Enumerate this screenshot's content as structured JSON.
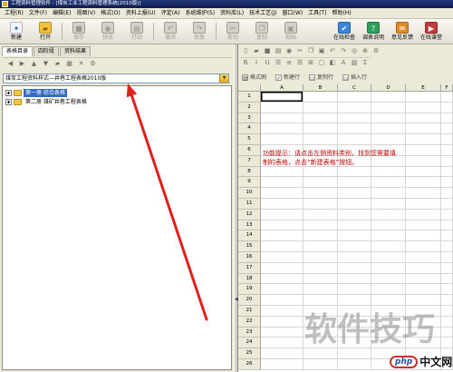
{
  "window": {
    "title": "工程资料管理软件 - [煤炭工业工程资料管理系统(2010版)]"
  },
  "menu": [
    "工程(R)",
    "文件(F)",
    "编辑(E)",
    "视图(V)",
    "格式(O)",
    "资料上报(U)",
    "评定(A)",
    "系统维护(S)",
    "资料库(L)",
    "技术工艺(J)",
    "窗口(W)",
    "工具(T)",
    "帮助(H)"
  ],
  "toolbar": {
    "buttons": [
      {
        "label": "新建",
        "icon": "new-file-icon",
        "enabled": true
      },
      {
        "label": "打开",
        "icon": "open-folder-icon",
        "enabled": true
      },
      {
        "label": "保存",
        "icon": "save-icon",
        "enabled": false
      },
      {
        "label": "预览",
        "icon": "preview-icon",
        "enabled": false
      },
      {
        "label": "打印",
        "icon": "print-icon",
        "enabled": false
      },
      {
        "label": "撤消",
        "icon": "undo-icon",
        "enabled": false
      },
      {
        "label": "恢复",
        "icon": "redo-icon",
        "enabled": false
      },
      {
        "label": "剪切",
        "icon": "cut-icon",
        "enabled": false
      },
      {
        "label": "复制",
        "icon": "copy-icon",
        "enabled": false
      },
      {
        "label": "粘贴",
        "icon": "paste-icon",
        "enabled": false
      }
    ],
    "right_buttons": [
      {
        "label": "在线检查",
        "icon": "online-check-icon",
        "enabled": true
      },
      {
        "label": "调表说明",
        "icon": "table-help-icon",
        "enabled": true
      },
      {
        "label": "意见反馈",
        "icon": "feedback-icon",
        "enabled": true
      },
      {
        "label": "在线课堂",
        "icon": "online-class-icon",
        "enabled": true
      }
    ]
  },
  "left_panel": {
    "tabs": [
      {
        "label": "表格目录",
        "active": true
      },
      {
        "label": "四阶段",
        "active": false
      },
      {
        "label": "资料结果",
        "active": false
      }
    ],
    "tools": [
      "back-icon",
      "forward-icon",
      "up-icon",
      "down-icon",
      "new-folder-icon",
      "properties-icon",
      "delete-icon",
      "settings-icon"
    ],
    "catalog_select": {
      "value": "煤炭工程资料样式—井巷工程表格2010版"
    },
    "tree": [
      {
        "label": "第一册 综合表格",
        "selected": true
      },
      {
        "label": "第二册 煤矿井巷工程表格",
        "selected": false
      }
    ]
  },
  "sheet": {
    "toolbar_row1": [
      "sheet-new-icon",
      "sheet-open-icon",
      "sheet-save-icon",
      "sheet-print-icon",
      "sheet-preview-icon",
      "sheet-cut-icon",
      "sheet-copy-icon",
      "sheet-paste-icon",
      "sheet-undo-icon",
      "sheet-redo-icon",
      "sheet-find-icon",
      "sheet-zoom-icon",
      "sheet-settings-icon"
    ],
    "toolbar_row2": [
      "bold-icon",
      "italic-icon",
      "underline-icon",
      "align-left-icon",
      "align-center-icon",
      "align-right-icon",
      "merge-cells-icon",
      "borders-icon",
      "fill-color-icon",
      "font-color-icon",
      "insert-image-icon",
      "formula-icon"
    ],
    "format_buttons": [
      {
        "label": "格式刷",
        "icon": "format-painter-icon"
      },
      {
        "label": "新建行",
        "icon": "new-row-icon"
      },
      {
        "label": "复制行",
        "icon": "copy-row-icon"
      },
      {
        "label": "插入行",
        "icon": "insert-row-icon"
      }
    ],
    "columns": [
      "A",
      "B",
      "C",
      "D",
      "E",
      "F"
    ],
    "rows": [
      "1",
      "2",
      "3",
      "4",
      "5",
      "6",
      "7",
      "8",
      "9",
      "10",
      "11",
      "12",
      "13",
      "14",
      "15",
      "16",
      "17",
      "18",
      "19",
      "20",
      "21",
      "22",
      "23",
      "24",
      "25",
      "26"
    ],
    "selected_cell": [
      0,
      0
    ],
    "hint": [
      "功能提示：请点击左侧资料类别，找到您需要填",
      "制的表格，点击“新建表格”按钮。"
    ]
  },
  "watermark": {
    "text": "软件技巧",
    "logo_php": "php",
    "logo_cn": "中文网"
  },
  "colors": {
    "selection": "#316ac5",
    "hint": "#c00000",
    "annotation": "#e0201c"
  }
}
